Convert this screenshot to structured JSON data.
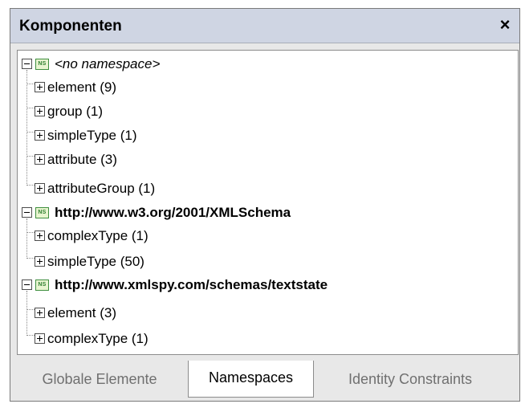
{
  "panel": {
    "title": "Komponenten",
    "close_glyph": "×"
  },
  "tree": {
    "namespaces": [
      {
        "name": "<no namespace>",
        "icon_text": "NS",
        "children": [
          {
            "label": "element (9)"
          },
          {
            "label": "group (1)"
          },
          {
            "label": "simpleType (1)"
          },
          {
            "label": "attribute (3)"
          },
          {
            "label": "attributeGroup (1)"
          }
        ]
      },
      {
        "name": "http://www.w3.org/2001/XMLSchema",
        "icon_text": "NS",
        "children": [
          {
            "label": "complexType (1)"
          },
          {
            "label": "simpleType (50)"
          }
        ]
      },
      {
        "name": "http://www.xmlspy.com/schemas/textstate",
        "icon_text": "NS",
        "children": [
          {
            "label": "element (3)"
          },
          {
            "label": "complexType (1)"
          }
        ]
      }
    ]
  },
  "tabs": [
    {
      "label": "Globale Elemente",
      "active": false
    },
    {
      "label": "Namespaces",
      "active": true
    },
    {
      "label": "Identity Constraints",
      "active": false
    }
  ],
  "icons": {
    "collapse": "minus-box-icon",
    "expand": "plus-box-icon",
    "namespace": "namespace-icon",
    "close": "close-icon"
  },
  "colors": {
    "titlebar": "#cfd5e3",
    "panel_bg": "#e8e8e8",
    "namespace_icon": "#3f8f3f",
    "inactive_tab_text": "#707070"
  }
}
